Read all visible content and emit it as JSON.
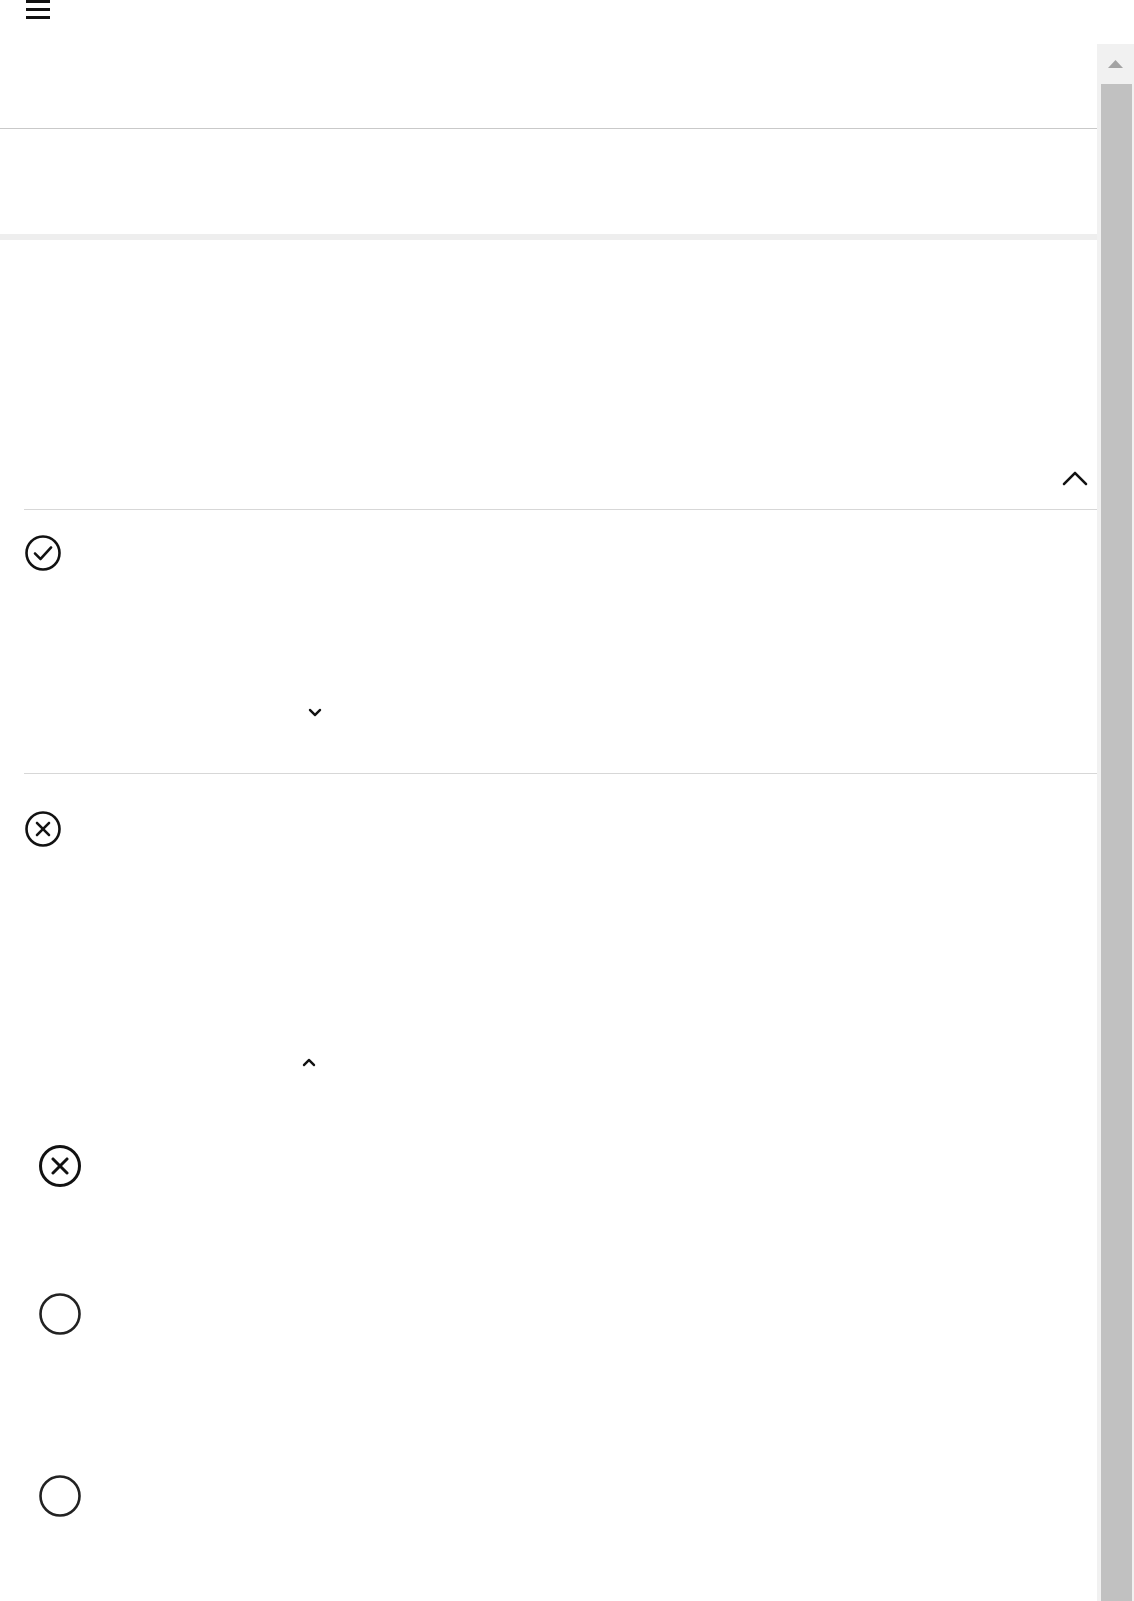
{
  "header": {
    "menu_icon": "hamburger-menu-icon"
  },
  "section": {
    "collapse_icon": "chevron-up-icon"
  },
  "items": [
    {
      "status_icon": "check-circle-icon",
      "toggle_icon": "chevron-down-icon"
    },
    {
      "status_icon": "x-circle-icon",
      "toggle_icon": "chevron-up-icon"
    }
  ],
  "options": [
    {
      "icon": "x-circle-icon",
      "state": "selected-incorrect"
    },
    {
      "icon": "empty-circle-icon",
      "state": "unselected"
    },
    {
      "icon": "empty-circle-icon",
      "state": "unselected"
    }
  ],
  "scrollbar": {
    "up_icon": "scroll-up-arrow-icon"
  },
  "colors": {
    "icon": "#111111",
    "divider": "#d7d7d7",
    "scroll_track": "#f1f1f1",
    "scroll_thumb": "#c1c1c1"
  }
}
